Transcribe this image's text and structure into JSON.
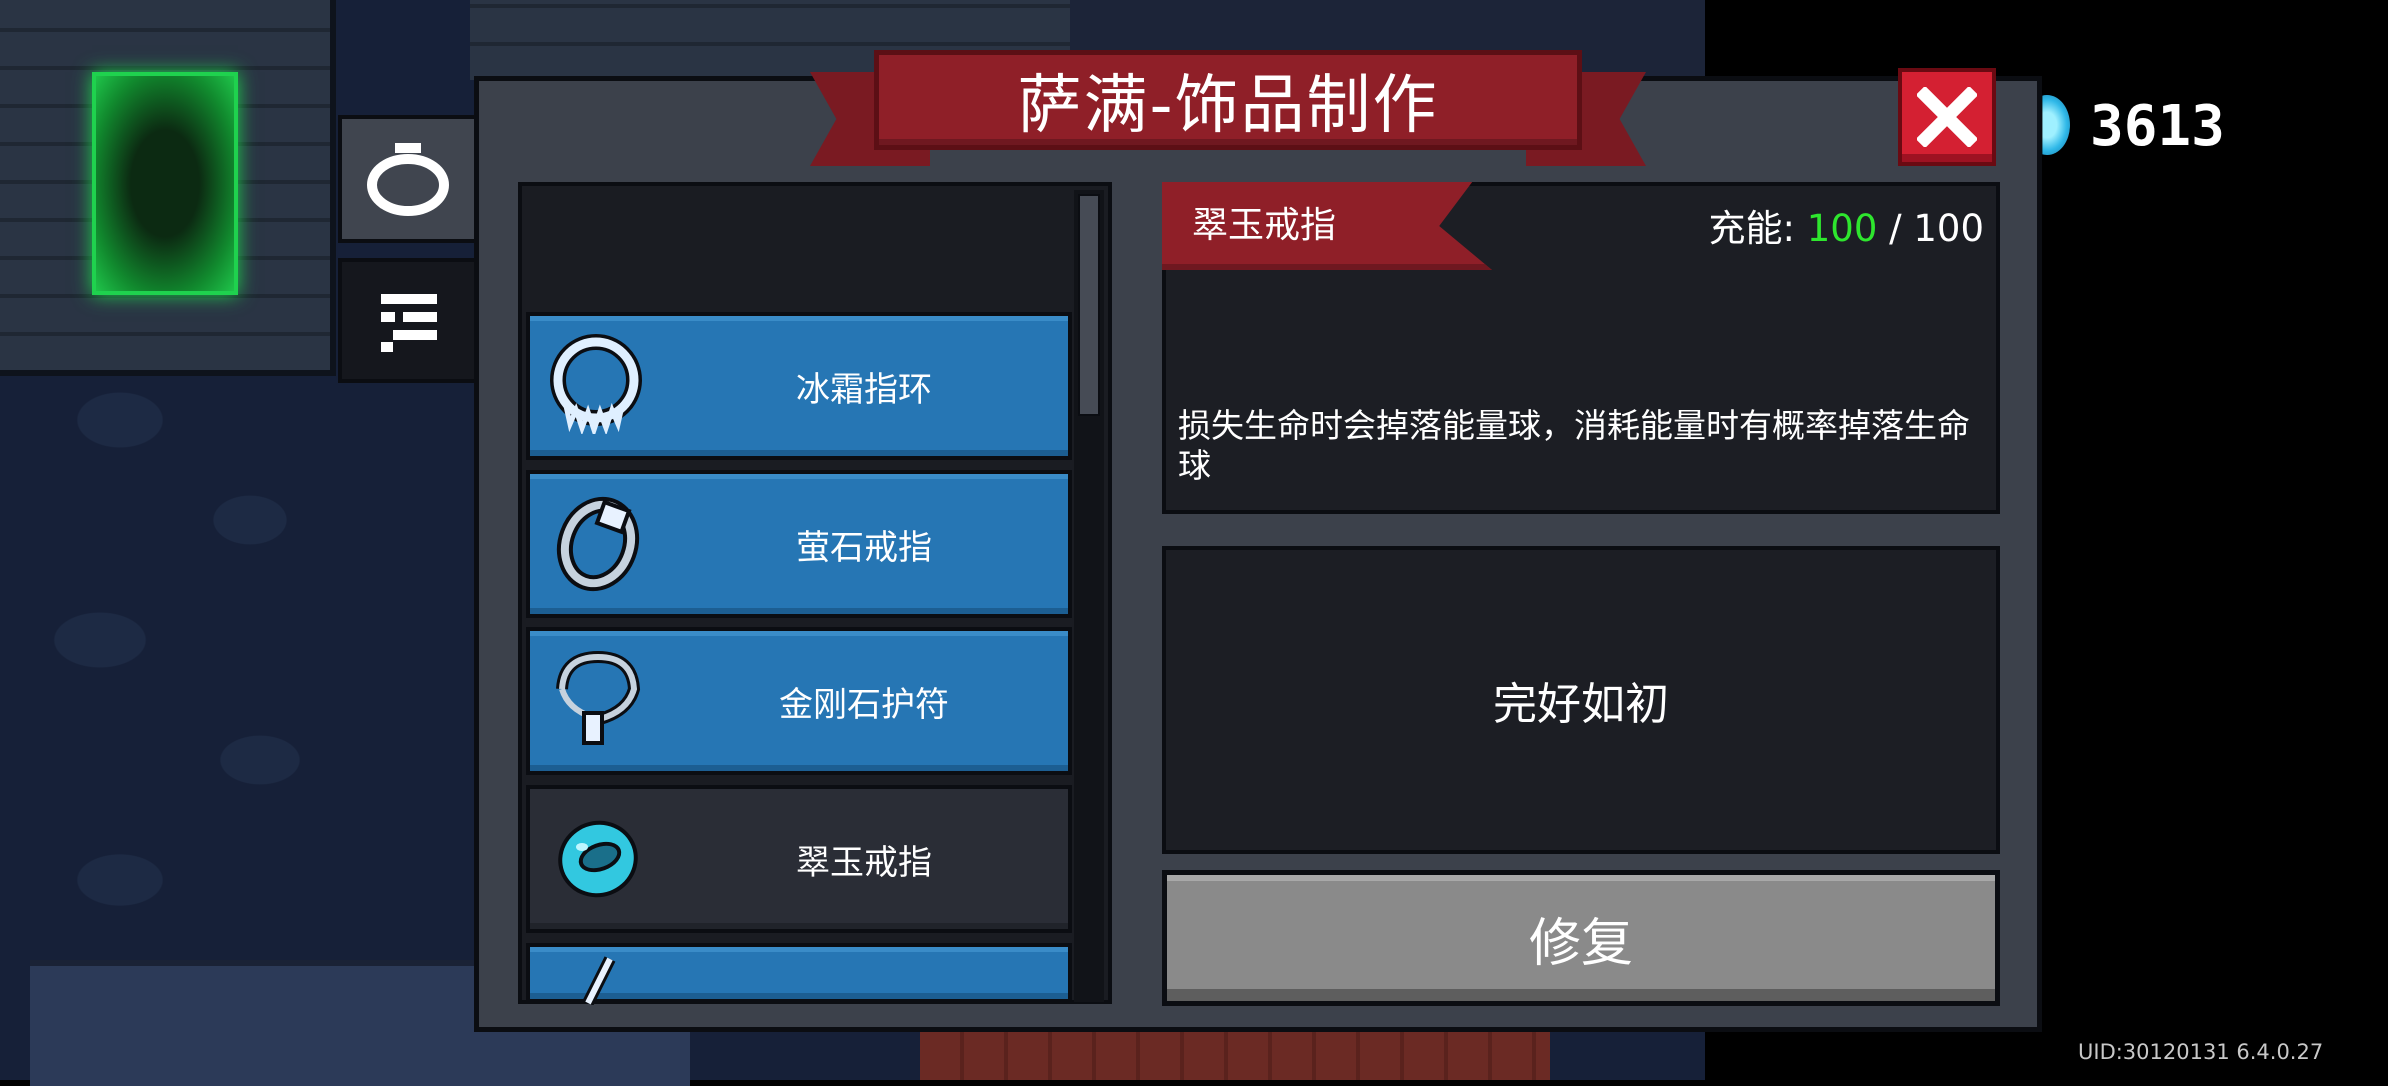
{
  "window": {
    "title": "萨满-饰品制作"
  },
  "currency": {
    "icon": "blue-gem-icon",
    "amount": "3613"
  },
  "side_tabs": [
    {
      "name": "accessory-tab",
      "icon": "ring-icon",
      "active": true
    },
    {
      "name": "list-tab",
      "icon": "list-icon",
      "active": false
    }
  ],
  "items": [
    {
      "label": "冰霜指环",
      "icon": "frost-ring-icon",
      "selected": false
    },
    {
      "label": "萤石戒指",
      "icon": "fluorite-ring-icon",
      "selected": false
    },
    {
      "label": "金刚石护符",
      "icon": "diamond-amulet-icon",
      "selected": false
    },
    {
      "label": "翠玉戒指",
      "icon": "jade-ring-icon",
      "selected": true
    },
    {
      "label": "",
      "icon": "sword-pendant-icon",
      "selected": false
    }
  ],
  "detail": {
    "name": "翠玉戒指",
    "charge_label": "充能:",
    "charge_current": "100",
    "charge_max": "/ 100",
    "description": "损失生命时会掉落能量球，消耗能量时有概率掉落生命球",
    "status": "完好如初"
  },
  "actions": {
    "repair_label": "修复"
  },
  "footer": {
    "uid": "UID:30120131 6.4.0.27"
  },
  "colors": {
    "banner_red": "#8f1f28",
    "item_blue": "#2676b4",
    "charge_green": "#2ee62e",
    "close_red": "#d42032"
  }
}
